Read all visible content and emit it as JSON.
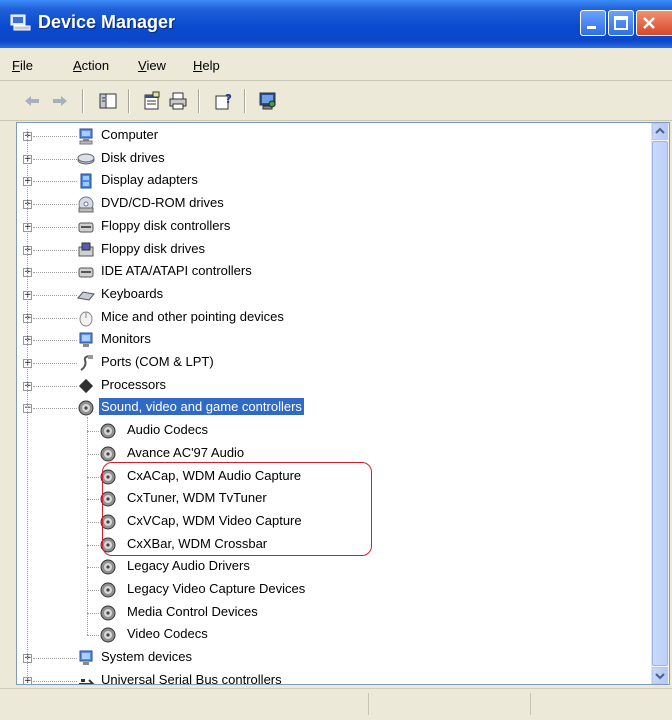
{
  "window": {
    "title": "Device Manager"
  },
  "menu": [
    {
      "label": "File",
      "u": "F",
      "rest": "ile"
    },
    {
      "label": "Action",
      "u": "A",
      "rest": "ction"
    },
    {
      "label": "View",
      "u": "V",
      "rest": "iew"
    },
    {
      "label": "Help",
      "u": "H",
      "rest": "elp"
    }
  ],
  "toolbar": {
    "icons": [
      "back-icon",
      "forward-icon",
      "show-hide-console-tree-icon",
      "properties-icon",
      "print-icon",
      "help-icon",
      "scan-hardware-icon"
    ]
  },
  "tree": {
    "categories": [
      {
        "label": "Computer",
        "icon": "computer-icon"
      },
      {
        "label": "Disk drives",
        "icon": "disk-drive-icon"
      },
      {
        "label": "Display adapters",
        "icon": "display-adapter-icon"
      },
      {
        "label": "DVD/CD-ROM drives",
        "icon": "cd-drive-icon"
      },
      {
        "label": "Floppy disk controllers",
        "icon": "floppy-controller-icon"
      },
      {
        "label": "Floppy disk drives",
        "icon": "floppy-drive-icon"
      },
      {
        "label": "IDE ATA/ATAPI controllers",
        "icon": "ide-controller-icon"
      },
      {
        "label": "Keyboards",
        "icon": "keyboard-icon"
      },
      {
        "label": "Mice and other pointing devices",
        "icon": "mouse-icon"
      },
      {
        "label": "Monitors",
        "icon": "monitor-icon"
      },
      {
        "label": "Ports (COM & LPT)",
        "icon": "port-icon"
      },
      {
        "label": "Processors",
        "icon": "processor-icon"
      },
      {
        "label": "Sound, video and game controllers",
        "icon": "sound-icon",
        "selected": true,
        "expanded": true
      }
    ],
    "sound_children": [
      "Audio Codecs",
      "Avance AC'97 Audio",
      "CxACap, WDM Audio Capture",
      "CxTuner, WDM TvTuner",
      "CxVCap, WDM Video Capture",
      "CxXBar, WDM Crossbar",
      "Legacy Audio Drivers",
      "Legacy Video Capture Devices",
      "Media Control Devices",
      "Video Codecs"
    ],
    "trailing": [
      {
        "label": "System devices",
        "icon": "system-device-icon"
      },
      {
        "label": "Universal Serial Bus controllers",
        "icon": "usb-icon"
      }
    ]
  },
  "colors": {
    "selection": "#316ac5",
    "annotation": "#d02030",
    "titlebar": "#0a4ad0"
  }
}
